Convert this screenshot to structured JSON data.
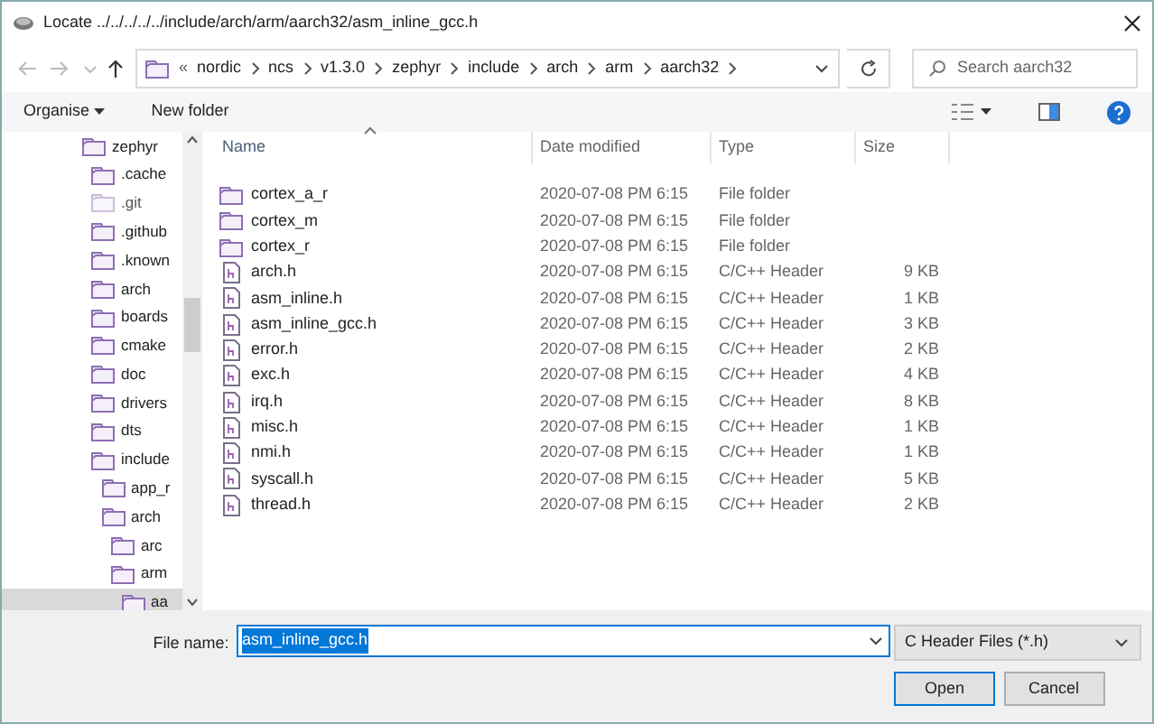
{
  "window": {
    "title": "Locate ../../../../../include/arch/arm/aarch32/asm_inline_gcc.h"
  },
  "address": {
    "overflow": "«",
    "crumbs": [
      "nordic",
      "ncs",
      "v1.3.0",
      "zephyr",
      "include",
      "arch",
      "arm",
      "aarch32"
    ]
  },
  "search": {
    "placeholder": "Search aarch32"
  },
  "toolbar": {
    "organise": "Organise",
    "new_folder": "New folder"
  },
  "tree": [
    {
      "label": "zephyr",
      "hidden": false,
      "selected": false,
      "children": [
        {
          "label": ".cache",
          "hidden": false,
          "selected": false
        },
        {
          "label": ".git",
          "hidden": true,
          "selected": false
        },
        {
          "label": ".github",
          "hidden": false,
          "selected": false
        },
        {
          "label": ".known",
          "hidden": false,
          "selected": false
        },
        {
          "label": "arch",
          "hidden": false,
          "selected": false
        },
        {
          "label": "boards",
          "hidden": false,
          "selected": false
        },
        {
          "label": "cmake",
          "hidden": false,
          "selected": false
        },
        {
          "label": "doc",
          "hidden": false,
          "selected": false
        },
        {
          "label": "drivers",
          "hidden": false,
          "selected": false
        },
        {
          "label": "dts",
          "hidden": false,
          "selected": false
        },
        {
          "label": "include",
          "hidden": false,
          "selected": false,
          "children": [
            {
              "label": "app_r",
              "hidden": false,
              "selected": false
            },
            {
              "label": "arch",
              "hidden": false,
              "selected": false,
              "children": [
                {
                  "label": "arc",
                  "hidden": false,
                  "selected": false
                },
                {
                  "label": "arm",
                  "hidden": false,
                  "selected": false,
                  "children": [
                    {
                      "label": "aa",
                      "hidden": false,
                      "selected": true
                    }
                  ]
                }
              ]
            }
          ]
        }
      ]
    }
  ],
  "table": {
    "columns": [
      "Name",
      "Date modified",
      "Type",
      "Size"
    ],
    "rows": [
      {
        "kind": "folder",
        "name": "cortex_a_r",
        "date": "2020-07-08 PM 6:15",
        "type": "File folder"
      },
      {
        "kind": "folder",
        "name": "cortex_m",
        "date": "2020-07-08 PM 6:15",
        "type": "File folder"
      },
      {
        "kind": "folder",
        "name": "cortex_r",
        "date": "2020-07-08 PM 6:15",
        "type": "File folder"
      },
      {
        "kind": "file",
        "name": "arch.h",
        "date": "2020-07-08 PM 6:15",
        "type": "C/C++ Header",
        "size": "9 KB"
      },
      {
        "kind": "file",
        "name": "asm_inline.h",
        "date": "2020-07-08 PM 6:15",
        "type": "C/C++ Header",
        "size": "1 KB"
      },
      {
        "kind": "file",
        "name": "asm_inline_gcc.h",
        "date": "2020-07-08 PM 6:15",
        "type": "C/C++ Header",
        "size": "3 KB"
      },
      {
        "kind": "file",
        "name": "error.h",
        "date": "2020-07-08 PM 6:15",
        "type": "C/C++ Header",
        "size": "2 KB"
      },
      {
        "kind": "file",
        "name": "exc.h",
        "date": "2020-07-08 PM 6:15",
        "type": "C/C++ Header",
        "size": "4 KB"
      },
      {
        "kind": "file",
        "name": "irq.h",
        "date": "2020-07-08 PM 6:15",
        "type": "C/C++ Header",
        "size": "8 KB"
      },
      {
        "kind": "file",
        "name": "misc.h",
        "date": "2020-07-08 PM 6:15",
        "type": "C/C++ Header",
        "size": "1 KB"
      },
      {
        "kind": "file",
        "name": "nmi.h",
        "date": "2020-07-08 PM 6:15",
        "type": "C/C++ Header",
        "size": "1 KB"
      },
      {
        "kind": "file",
        "name": "syscall.h",
        "date": "2020-07-08 PM 6:15",
        "type": "C/C++ Header",
        "size": "5 KB"
      },
      {
        "kind": "file",
        "name": "thread.h",
        "date": "2020-07-08 PM 6:15",
        "type": "C/C++ Header",
        "size": "2 KB"
      }
    ]
  },
  "file_name": {
    "label": "File name:",
    "value": "asm_inline_gcc.h"
  },
  "filter": {
    "value": "C Header Files (*.h)"
  },
  "buttons": [
    {
      "label": "Open",
      "default": true
    },
    {
      "label": "Cancel",
      "default": false
    }
  ]
}
